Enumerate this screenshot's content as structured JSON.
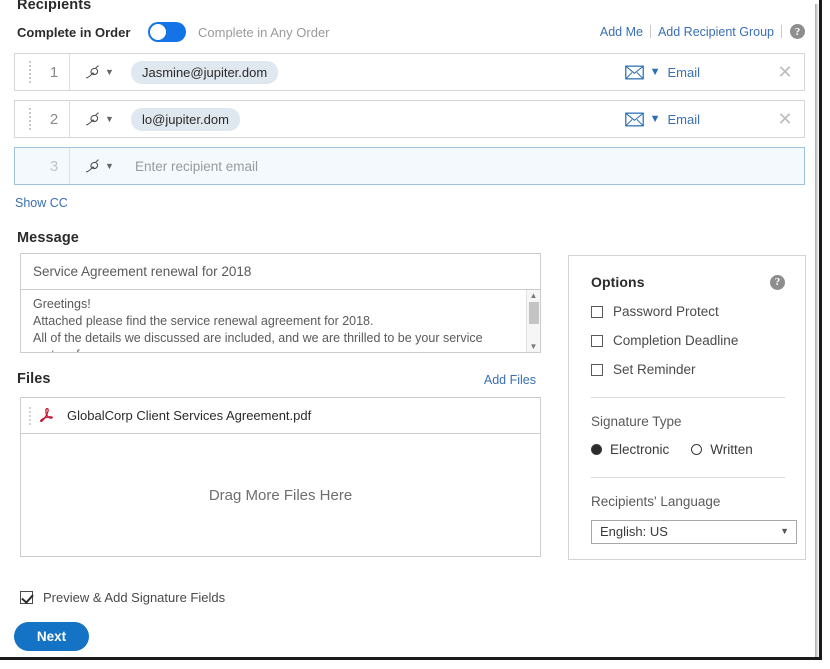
{
  "recipients": {
    "title": "Recipients",
    "order_on_label": "Complete in Order",
    "order_off_label": "Complete in Any Order",
    "toggle_state": "in-order",
    "add_me_label": "Add Me",
    "add_group_label": "Add Recipient Group",
    "help_glyph": "?",
    "show_cc_label": "Show CC",
    "rows": [
      {
        "num": "1",
        "email": "Jasmine@jupiter.dom",
        "placeholder": "",
        "delivery": "Email",
        "active": false
      },
      {
        "num": "2",
        "email": "lo@jupiter.dom",
        "placeholder": "",
        "delivery": "Email",
        "active": false
      },
      {
        "num": "3",
        "email": "",
        "placeholder": "Enter recipient email",
        "delivery": "",
        "active": true
      }
    ]
  },
  "message": {
    "title": "Message",
    "subject": "Service Agreement renewal for 2018",
    "body": "Greetings!\nAttached please find the service renewal agreement for 2018.\nAll of the details we discussed are included, and we are thrilled to be your service partner for"
  },
  "files": {
    "title": "Files",
    "add_files_label": "Add Files",
    "items": [
      {
        "name": "GlobalCorp Client Services Agreement.pdf",
        "type": "pdf"
      }
    ],
    "drag_hint": "Drag More Files Here"
  },
  "options": {
    "title": "Options",
    "help_glyph": "?",
    "checkboxes": [
      {
        "label": "Password Protect",
        "checked": false
      },
      {
        "label": "Completion Deadline",
        "checked": false
      },
      {
        "label": "Set Reminder",
        "checked": false
      }
    ],
    "signature_type_label": "Signature Type",
    "signature_options": [
      {
        "label": "Electronic",
        "selected": true
      },
      {
        "label": "Written",
        "selected": false
      }
    ],
    "language_label": "Recipients' Language",
    "language_value": "English: US"
  },
  "footer": {
    "preview_label": "Preview & Add Signature Fields",
    "preview_checked": true,
    "next_label": "Next"
  },
  "colors": {
    "accent_blue": "#1473c4",
    "link_blue": "#3a6fb5",
    "toggle_blue": "#1473e6",
    "chip_bg": "#dfe7ef",
    "active_row_bg": "#f3f9fd",
    "pdf_red": "#c8102e"
  }
}
